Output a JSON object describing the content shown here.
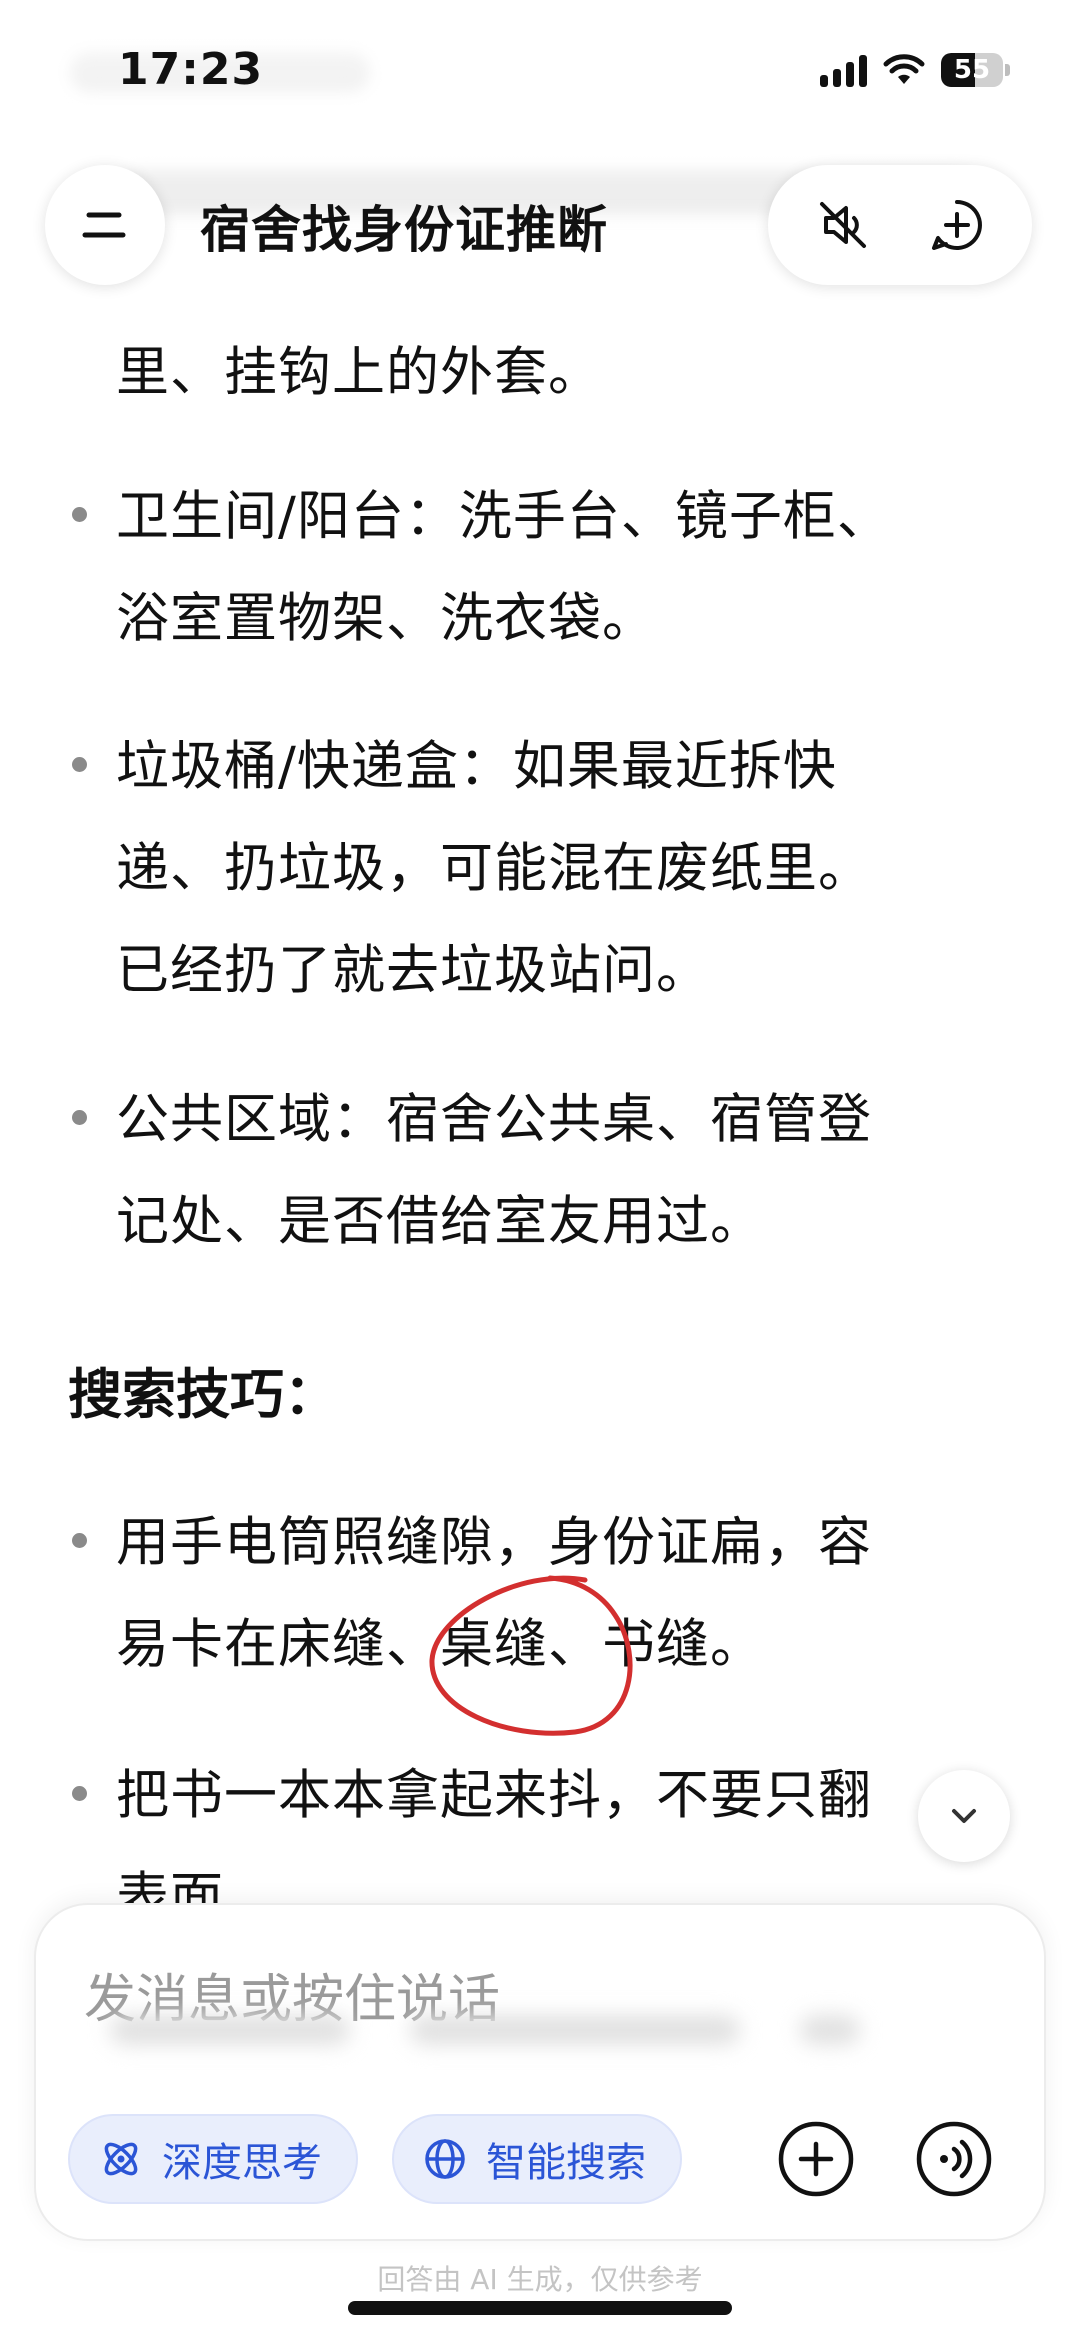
{
  "status_bar": {
    "time": "17:23",
    "battery": "55",
    "battery_level_percent": 55
  },
  "header": {
    "title": "宿舍找身份证推断",
    "menu_icon": "hamburger-menu-icon",
    "mute_icon": "speaker-muted-icon",
    "new_chat_icon": "new-chat-plus-icon"
  },
  "article": {
    "items": [
      {
        "lines": [
          "里、挂钩上的外套。"
        ],
        "bullet": false
      },
      {
        "lines": [
          "卫生间/阳台：洗手台、镜子柜、",
          "浴室置物架、洗衣袋。"
        ],
        "bullet": true
      },
      {
        "lines": [
          "垃圾桶/快递盒：如果最近拆快",
          "递、扔垃圾，可能混在废纸里。",
          "已经扔了就去垃圾站问。"
        ],
        "bullet": true
      },
      {
        "lines": [
          "公共区域：宿舍公共桌、宿管登",
          "记处、是否借给室友用过。"
        ],
        "bullet": true
      }
    ],
    "heading": "搜索技巧：",
    "tips": [
      {
        "lines": [
          "用手电筒照缝隙，身份证扁，容",
          "易卡在床缝、桌缝、书缝。"
        ]
      },
      {
        "lines": [
          "把书一本本拿起来抖，不要只翻",
          "表面"
        ]
      }
    ],
    "annotation_color": "#d32f2f"
  },
  "composer": {
    "placeholder": "发消息或按住说话",
    "chips": [
      {
        "label": "深度思考",
        "icon": "atom-icon"
      },
      {
        "label": "智能搜索",
        "icon": "globe-icon"
      }
    ],
    "add_icon": "plus-circle-icon",
    "voice_icon": "voice-call-icon"
  },
  "footer": {
    "disclaimer": "回答由 AI 生成，仅供参考"
  },
  "colors": {
    "accent": "#2b55d6",
    "chip_bg": "#e9eefc",
    "text": "#111111",
    "muted": "#9a9a9a"
  }
}
